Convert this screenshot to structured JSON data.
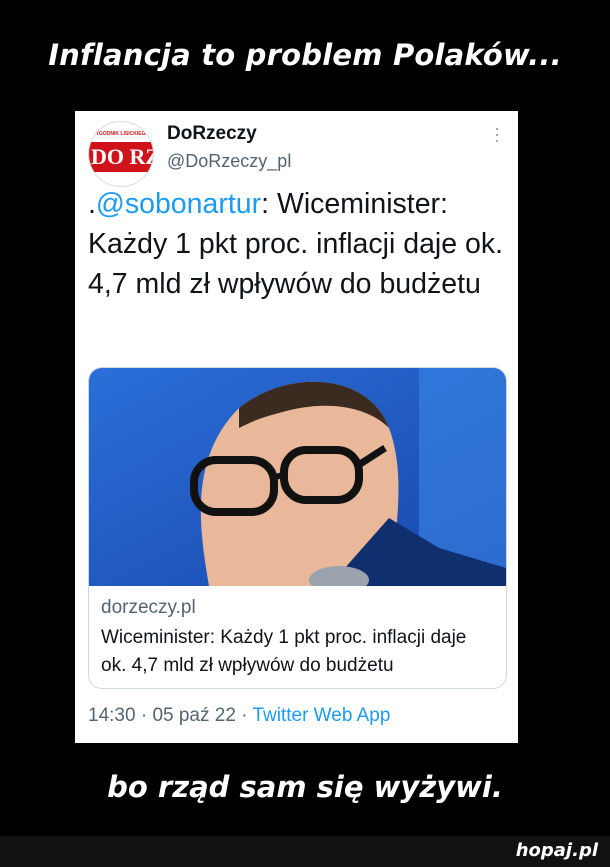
{
  "meme": {
    "top_caption": "Inflancja to problem Polaków...",
    "bottom_caption": "bo rząd sam się wyżywi."
  },
  "tweet": {
    "avatar_tagline": "TYGODNIK LISICKIEGO",
    "avatar_logo_text": "DO RZECZY",
    "display_name": "DoRzeczy",
    "handle": "@DoRzeczy_pl",
    "text_prefix": ".",
    "mention": "@sobonartur",
    "text_body": ": Wiceminister: Każdy 1 pkt proc. inflacji daje ok. 4,7 mld zł wpływów do budżetu",
    "link_card": {
      "domain": "dorzeczy.pl",
      "title": "Wiceminister: Każdy 1 pkt proc. inflacji daje ok. 4,7 mld zł wpływów do budżetu"
    },
    "time": "14:30",
    "separator": "·",
    "date": "05 paź 22",
    "app": "Twitter Web App"
  },
  "watermark": "hopaj.pl",
  "colors": {
    "accent": "#1d9bf0",
    "brand_red": "#d0121b",
    "muted": "#536471"
  }
}
